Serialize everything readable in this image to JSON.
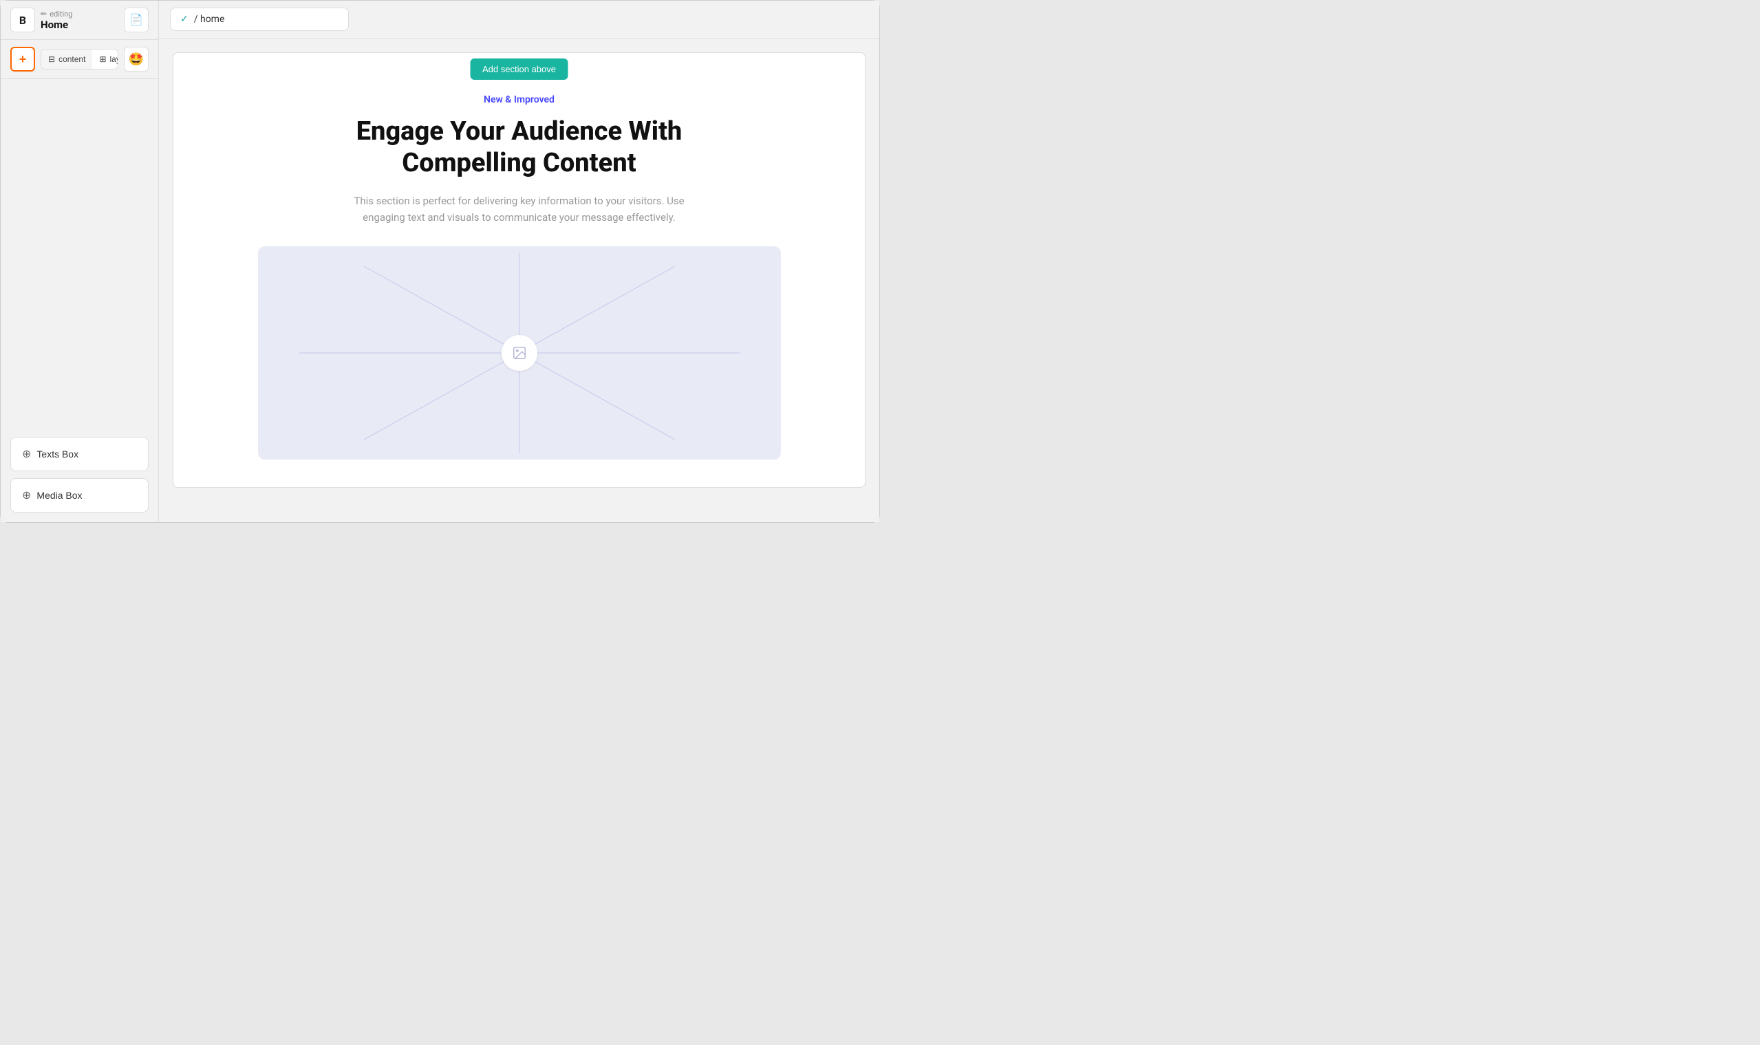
{
  "brand": {
    "letter": "B"
  },
  "header": {
    "editing_label": "editing",
    "page_title": "Home",
    "doc_icon": "📄"
  },
  "toolbar": {
    "add_icon": "+",
    "content_tab": "content",
    "layout_tab": "layout",
    "content_icon": "☰",
    "layout_icon": "⊞"
  },
  "url_bar": {
    "check": "✓",
    "url": "/ home"
  },
  "canvas": {
    "add_section_label": "Add section above",
    "new_improved": "New & Improved",
    "hero_title": "Engage Your Audience With Compelling Content",
    "hero_desc": "This section is perfect for delivering key information to your visitors. Use engaging text and visuals to communicate your message effectively."
  },
  "sidebar": {
    "texts_box_label": "Texts Box",
    "media_box_label": "Media Box"
  },
  "colors": {
    "teal": "#1ab5a0",
    "orange": "#f60",
    "blue_label": "#4444ff"
  }
}
